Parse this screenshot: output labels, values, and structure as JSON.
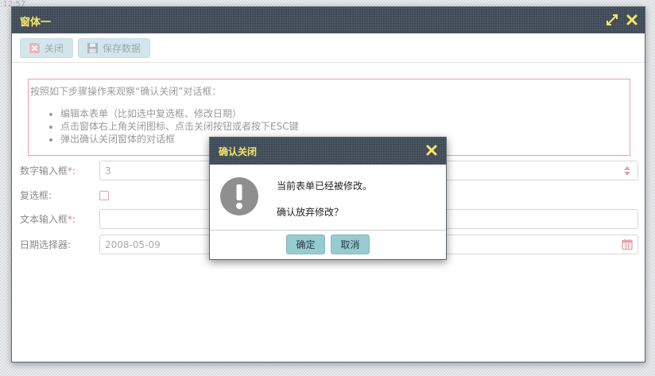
{
  "corner_text": ":12:57",
  "window": {
    "title": "窗体一",
    "toolbar": {
      "close_label": "关闭",
      "save_label": "保存数据"
    },
    "notice": {
      "intro": "按照如下步骤操作来观察“确认关闭”对话框：",
      "steps": [
        "编辑本表单（比如选中复选框、修改日期）",
        "点击窗体右上角关闭图标、点击关闭按钮或者按下ESC键",
        "弹出确认关闭窗体的对话框"
      ]
    },
    "form": {
      "number_label": "数字输入框",
      "number_value": "3",
      "checkbox_label": "复选框:",
      "text_label": "文本输入框",
      "text_value": "",
      "date_label": "日期选择器:",
      "date_value": "2008-05-09",
      "required_mark": "*",
      "colon": ":"
    }
  },
  "dialog": {
    "title": "确认关闭",
    "line1": "当前表单已经被修改。",
    "line2": "确认放弃修改？",
    "ok_label": "确定",
    "cancel_label": "取消"
  },
  "colors": {
    "header_bg": "#3f4a57",
    "title_yellow": "#f4e96a",
    "button_bg": "#97cbd2",
    "required_red": "#e57b86"
  }
}
